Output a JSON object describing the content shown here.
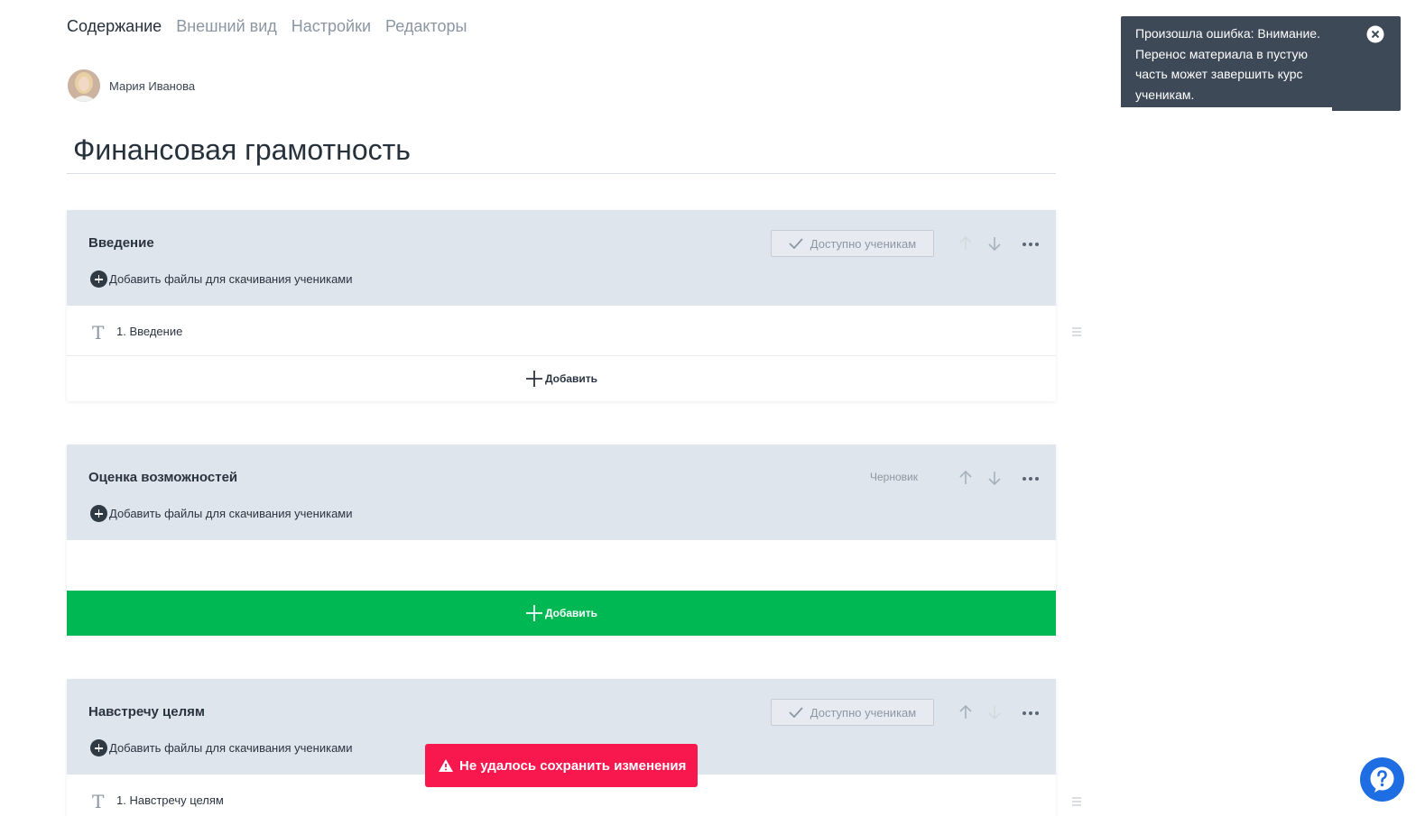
{
  "tabs": [
    {
      "label": "Содержание",
      "active": true
    },
    {
      "label": "Внешний вид",
      "active": false
    },
    {
      "label": "Настройки",
      "active": false
    },
    {
      "label": "Редакторы",
      "active": false
    }
  ],
  "author": {
    "name": "Мария Иванова"
  },
  "course": {
    "title": "Финансовая грамотность"
  },
  "sections": [
    {
      "title": "Введение",
      "add_files_label": "Добавить файлы для скачивания учениками",
      "status_label": "Доступно ученикам",
      "items": [
        {
          "label": "1. Введение"
        }
      ],
      "add_label": "Добавить"
    },
    {
      "title": "Оценка возможностей",
      "add_files_label": "Добавить файлы для скачивания учениками",
      "status_label": "Черновик",
      "items": [],
      "add_label": "Добавить"
    },
    {
      "title": "Навстречу целям",
      "add_files_label": "Добавить файлы для скачивания учениками",
      "status_label": "Доступно ученикам",
      "items": [
        {
          "label": "1. Навстречу целям"
        }
      ]
    }
  ],
  "toast": {
    "message": "Произошла ошибка: Внимание. Перенос материала в пустую часть может завершить курс ученикам."
  },
  "error_toast": {
    "message": "Не удалось сохранить изменения"
  },
  "colors": {
    "accent_green": "#00b853",
    "error_red": "#f8184e",
    "toast_bg": "#3e4957",
    "help_blue": "#1e6de3",
    "section_bg": "#dfe5ed"
  },
  "icons": [
    "check-icon",
    "arrow-up-icon",
    "arrow-down-icon",
    "more-dots-icon",
    "plus-circle-icon",
    "plus-icon",
    "text-type-icon",
    "drag-handle-icon",
    "close-icon",
    "warning-icon",
    "help-icon"
  ]
}
